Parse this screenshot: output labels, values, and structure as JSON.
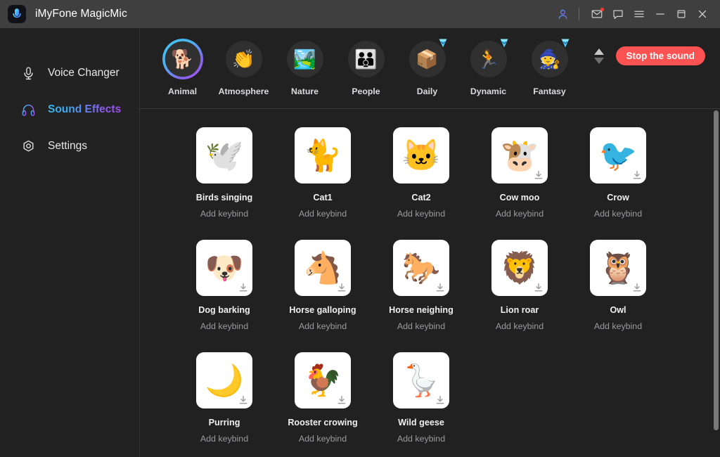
{
  "window": {
    "title": "iMyFone MagicMic",
    "logo_icon": "magicmic-logo-icon",
    "controls": [
      {
        "name": "account-icon",
        "glyph": "account"
      },
      {
        "name": "mail-icon",
        "glyph": "mail"
      },
      {
        "name": "feedback-icon",
        "glyph": "chat"
      },
      {
        "name": "menu-icon",
        "glyph": "hamburger"
      },
      {
        "name": "minimize-icon",
        "glyph": "minimize"
      },
      {
        "name": "maximize-icon",
        "glyph": "maximize"
      },
      {
        "name": "close-icon",
        "glyph": "close"
      }
    ]
  },
  "sidebar": {
    "items": [
      {
        "label": "Voice Changer",
        "icon": "microphone-icon",
        "active": false
      },
      {
        "label": "Sound Effects",
        "icon": "headphones-icon",
        "active": true
      },
      {
        "label": "Settings",
        "icon": "gear-icon",
        "active": false
      }
    ]
  },
  "categories": {
    "items": [
      {
        "label": "Animal",
        "emoji": "🐕",
        "selected": true,
        "premium": false
      },
      {
        "label": "Atmosphere",
        "emoji": "👏",
        "selected": false,
        "premium": false
      },
      {
        "label": "Nature",
        "emoji": "🏞️",
        "selected": false,
        "premium": false
      },
      {
        "label": "People",
        "emoji": "👪",
        "selected": false,
        "premium": false
      },
      {
        "label": "Daily",
        "emoji": "📦",
        "selected": false,
        "premium": true
      },
      {
        "label": "Dynamic",
        "emoji": "🏃",
        "selected": false,
        "premium": true
      },
      {
        "label": "Fantasy",
        "emoji": "🧙",
        "selected": false,
        "premium": true
      }
    ],
    "sort_up_icon": "sort-ascending-icon",
    "sort_down_icon": "sort-descending-icon",
    "stop_button_label": "Stop the sound"
  },
  "sounds": {
    "keybind_label": "Add keybind",
    "items": [
      {
        "title": "Birds singing",
        "emoji": "🕊️",
        "downloadable": false
      },
      {
        "title": "Cat1",
        "emoji": "🐈",
        "downloadable": false
      },
      {
        "title": "Cat2",
        "emoji": "🐱",
        "downloadable": false
      },
      {
        "title": "Cow moo",
        "emoji": "🐮",
        "downloadable": true
      },
      {
        "title": "Crow",
        "emoji": "🐦",
        "downloadable": true
      },
      {
        "title": "Dog barking",
        "emoji": "🐶",
        "downloadable": true
      },
      {
        "title": "Horse galloping",
        "emoji": "🐴",
        "downloadable": true
      },
      {
        "title": "Horse neighing",
        "emoji": "🐎",
        "downloadable": true
      },
      {
        "title": "Lion roar",
        "emoji": "🦁",
        "downloadable": true
      },
      {
        "title": "Owl",
        "emoji": "🦉",
        "downloadable": true
      },
      {
        "title": "Purring",
        "emoji": "🌙",
        "downloadable": true
      },
      {
        "title": "Rooster crowing",
        "emoji": "🐓",
        "downloadable": true
      },
      {
        "title": "Wild geese",
        "emoji": "🪿",
        "downloadable": true
      }
    ]
  },
  "colors": {
    "titlebar_bg": "#3f3f3f",
    "app_bg": "#212121",
    "sidebar_bg": "#222222",
    "accent_start": "#3fc9f5",
    "accent_end": "#a855f7",
    "stop_button_bg": "#fd5252",
    "premium_gem": "#4fd4f7",
    "notification_dot": "#ff3b30"
  }
}
